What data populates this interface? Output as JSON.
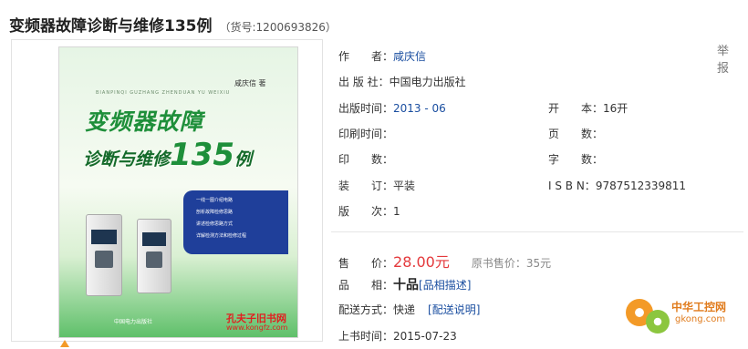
{
  "title": "变频器故障诊断与维修135例",
  "sku": "（货号:1200693826）",
  "report_label": "举 报",
  "cover": {
    "author_line": "咸庆信 著",
    "pinyin": "BIANPINQI GUZHANG ZHENDUAN YU WEIXIU",
    "title_line1": "变频器故障",
    "title_line2_text": "诊断与维修",
    "title_line2_num": "135",
    "title_line2_suffix": "例",
    "bullets": [
      "一线一图介绍电路",
      "剖析故障检修思路",
      "讲述检修思路方式",
      "详解检测方法和检修过程"
    ],
    "watermark_name": "孔夫子旧书网",
    "watermark_url": "www.kongfz.com",
    "publisher_mark": "中国电力出版社"
  },
  "info": {
    "author_label": "作　　者：",
    "author": "咸庆信",
    "publisher_label": "出 版 社：",
    "publisher": "中国电力出版社",
    "pubdate_label": "出版时间：",
    "pubdate": "2013 - 06",
    "format_label": "开　　本：",
    "format": "16开",
    "printdate_label": "印刷时间：",
    "printdate": "",
    "pages_label": "页　　数：",
    "pages": "",
    "impression_label": "印　　数：",
    "impression": "",
    "words_label": "字　　数：",
    "words": "",
    "binding_label": "装　　订：",
    "binding": "平装",
    "isbn_label": "I S B N：",
    "isbn": "9787512339811",
    "edition_label": "版　　次：",
    "edition": "1"
  },
  "sale": {
    "price_label": "售　　价：",
    "price": "28.00元",
    "original_label": "原书售价：",
    "original": "35元",
    "condition_label": "品　　相：",
    "condition": "十品",
    "condition_link": "[品相描述]",
    "shipping_label": "配送方式：",
    "shipping": "快递",
    "shipping_link": "[配送说明]",
    "listed_label": "上书时间：",
    "listed": "2015-07-23"
  },
  "site_watermark": {
    "name": "中华工控网",
    "domain": "gkong.com"
  },
  "colors": {
    "price": "#e4393c",
    "link": "#1a4ea0",
    "cover_green": "#1e8f3a"
  }
}
